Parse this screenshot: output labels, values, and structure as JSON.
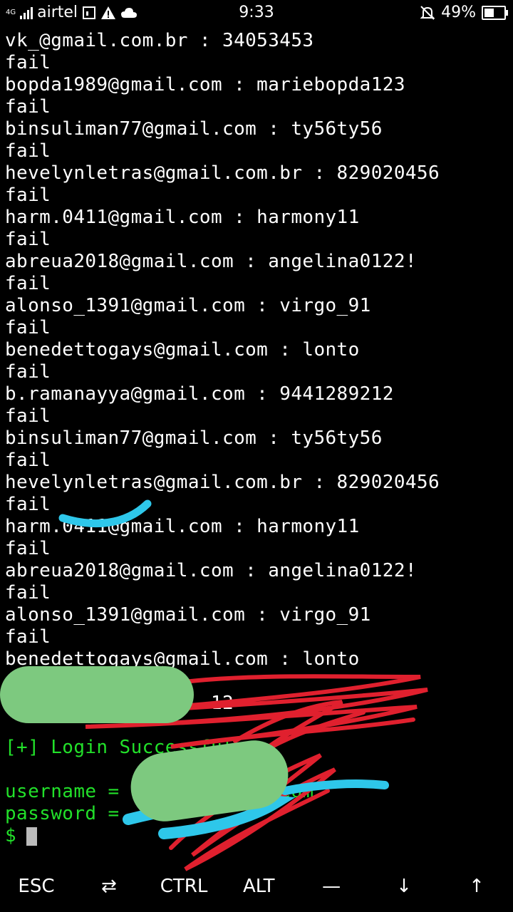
{
  "status_bar": {
    "network": "4G",
    "carrier": "airtel",
    "time": "9:33",
    "battery_percent": "49%",
    "battery_level": 0.49
  },
  "terminal": {
    "lines": [
      {
        "text": "vk_@gmail.com.br : 34053453",
        "color": "white"
      },
      {
        "text": "fail",
        "color": "white"
      },
      {
        "text": "bopda1989@gmail.com : mariebopda123",
        "color": "white"
      },
      {
        "text": "fail",
        "color": "white"
      },
      {
        "text": "binsuliman77@gmail.com : ty56ty56",
        "color": "white"
      },
      {
        "text": "fail",
        "color": "white"
      },
      {
        "text": "hevelynletras@gmail.com.br : 829020456",
        "color": "white"
      },
      {
        "text": "fail",
        "color": "white"
      },
      {
        "text": "harm.0411@gmail.com : harmony11",
        "color": "white"
      },
      {
        "text": "fail",
        "color": "white"
      },
      {
        "text": "abreua2018@gmail.com : angelina0122!",
        "color": "white"
      },
      {
        "text": "fail",
        "color": "white"
      },
      {
        "text": "alonso_1391@gmail.com : virgo_91",
        "color": "white"
      },
      {
        "text": "fail",
        "color": "white"
      },
      {
        "text": "benedettogays@gmail.com : lonto",
        "color": "white"
      },
      {
        "text": "fail",
        "color": "white"
      },
      {
        "text": "b.ramanayya@gmail.com : 9441289212",
        "color": "white"
      },
      {
        "text": "fail",
        "color": "white"
      },
      {
        "text": "binsuliman77@gmail.com : ty56ty56",
        "color": "white"
      },
      {
        "text": "fail",
        "color": "white"
      },
      {
        "text": "hevelynletras@gmail.com.br : 829020456",
        "color": "white"
      },
      {
        "text": "fail",
        "color": "white"
      },
      {
        "text": "harm.0411@gmail.com : harmony11",
        "color": "white"
      },
      {
        "text": "fail",
        "color": "white"
      },
      {
        "text": "abreua2018@gmail.com : angelina0122!",
        "color": "white"
      },
      {
        "text": "fail",
        "color": "white"
      },
      {
        "text": "alonso_1391@gmail.com : virgo_91",
        "color": "white"
      },
      {
        "text": "fail",
        "color": "white"
      },
      {
        "text": "benedettogays@gmail.com : lonto",
        "color": "white"
      },
      {
        "text": "",
        "color": "white"
      },
      {
        "text": "                  12",
        "color": "white"
      },
      {
        "text": "",
        "color": "white"
      },
      {
        "text": "[+] Login Successful",
        "color": "green"
      },
      {
        "text": "",
        "color": "white"
      },
      {
        "text": "username =             .com",
        "color": "green"
      },
      {
        "text": "password =",
        "color": "green"
      }
    ],
    "prompt": "$"
  },
  "extra_keys": [
    "ESC",
    "⇄",
    "CTRL",
    "ALT",
    "—",
    "↓",
    "↑"
  ],
  "colors": {
    "background": "#000000",
    "text": "#ffffff",
    "success_green": "#22e02a",
    "redaction_green": "#7dc97f",
    "redaction_red": "#e0202e",
    "redaction_blue": "#2ec7ea"
  }
}
